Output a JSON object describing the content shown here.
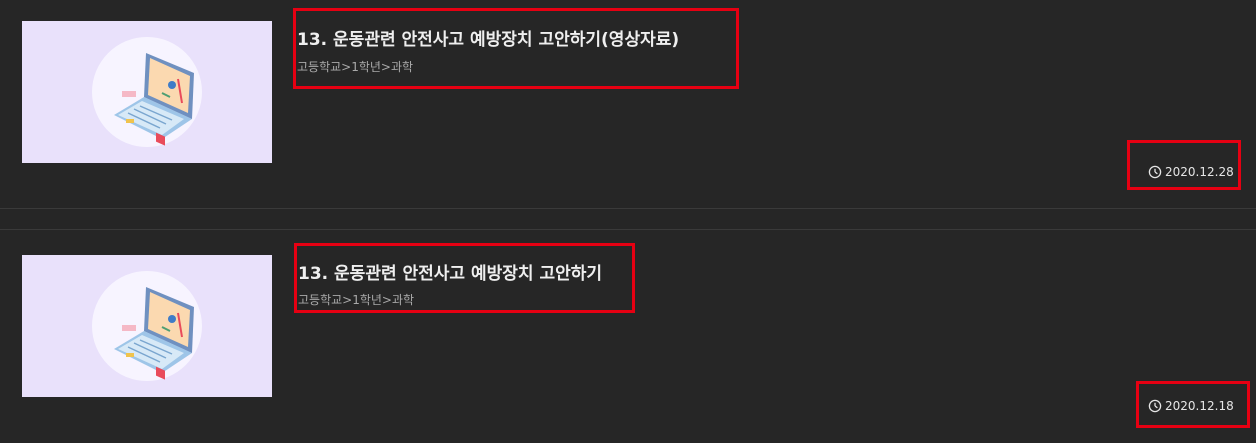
{
  "items": [
    {
      "title": "13. 운동관련 안전사고 예방장치 고안하기(영상자료)",
      "path": "고등학교>1학년>과학",
      "date": "2020.12.28",
      "thumbnail_icon": "laptop-illustration-icon"
    },
    {
      "title": "13. 운동관련 안전사고 예방장치 고안하기",
      "path": "고등학교>1학년>과학",
      "date": "2020.12.18",
      "thumbnail_icon": "laptop-illustration-icon"
    }
  ],
  "colors": {
    "background": "#262626",
    "highlight_box": "#e60012",
    "thumbnail_bg": "#e9e1fb",
    "title_text": "#efefef",
    "path_text": "#a9a9a9"
  }
}
